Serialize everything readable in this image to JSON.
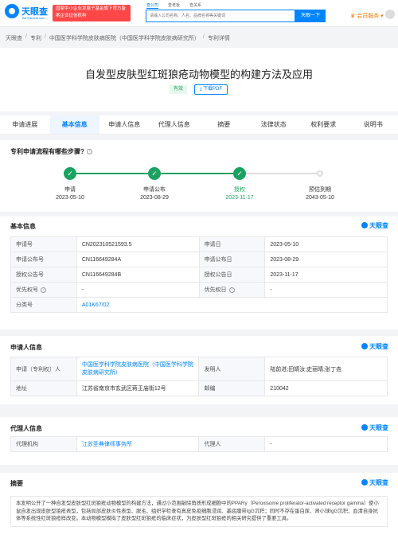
{
  "header": {
    "logo_text": "天眼查",
    "logo_sub": "TianYancha.com",
    "gov_badge": "国家中小企业发展子基金旗下官方备案企业征信机构",
    "search_tabs": [
      "查公司",
      "查老板",
      "查关系"
    ],
    "search_placeholder": "请输入公司名称、人名、品牌名称等关键词",
    "search_button": "天眼一下",
    "member": "会员服务"
  },
  "breadcrumb": [
    "天眼查",
    "专利",
    "中国医学科学院皮肤病医院（中国医学科学院皮肤病研究所）",
    "专利详情"
  ],
  "title": {
    "text": "自发型皮肤型红斑狼疮动物模型的构建方法及应用",
    "status": "有效",
    "pdf_button": "下载PDF"
  },
  "tabs": [
    "申请进展",
    "基本信息",
    "申请人信息",
    "代理人信息",
    "摘要",
    "法律状态",
    "权利要求",
    "说明书"
  ],
  "active_tab": 1,
  "progress": {
    "heading": "专利申请流程有哪些步骤?",
    "steps": [
      {
        "label": "申请",
        "date": "2023-05-10",
        "status": "done"
      },
      {
        "label": "申请公布",
        "date": "2023-08-29",
        "status": "done"
      },
      {
        "label": "授权",
        "date": "2023-11-17",
        "status": "current"
      },
      {
        "label": "预估到期",
        "date": "2043-05-10",
        "status": "pending"
      }
    ]
  },
  "watermark": "天眼查",
  "basic": {
    "heading": "基本信息",
    "rows": [
      [
        "申请号",
        "CN202310521593.5",
        "申请日",
        "2023-05-10"
      ],
      [
        "申请公布号",
        "CN116649284A",
        "申请公布日",
        "2023-08-29"
      ],
      [
        "授权公告号",
        "CN116649284B",
        "授权公告日",
        "2023-11-17"
      ],
      [
        "优先权号",
        "-",
        "优先权日",
        "-"
      ]
    ],
    "class_label": "分类号",
    "class_value": "A01K67/02"
  },
  "applicant": {
    "heading": "申请人信息",
    "applicant_label": "申请（专利权）人",
    "applicant_value": "中国医学科学院皮肤病医院（中国医学科学院皮肤病研究所）",
    "inventor_label": "发明人",
    "inventor_value": "陆前进;田婧汝;史丽晴;张丁垚",
    "address_label": "地址",
    "address_value": "江苏省南京市玄武区蒋王庙街12号",
    "postcode_label": "邮编",
    "postcode_value": "210042"
  },
  "agent": {
    "heading": "代理人信息",
    "agency_label": "代理机构",
    "agency_value": "江苏圣典律师事务所",
    "agent_label": "代理人",
    "agent_value": "-"
  },
  "abstract": {
    "heading": "摘要",
    "text": "本发明公开了一种自发型皮肤型红斑狼疮动物模型的构建方法，通过小范围敲除角质形成细胞中的PPARγ（Peroxisome proliferator-activated receptor gamma）使小鼠自发出现皮肤型狼疮表型，包括局部皮肤炎性表型、脱毛、组织学检查有真皮免疫细胞浸润、基底膜带IgG沉积；同时不存在蛋白尿、肾小球IgG沉积、血清自身抗体等系统性红斑狼疮样改变。本动物模型模拟了皮肤型红斑狼疮的临床症状，为皮肤型红斑狼疮的相关研究提供了重要工具。"
  }
}
